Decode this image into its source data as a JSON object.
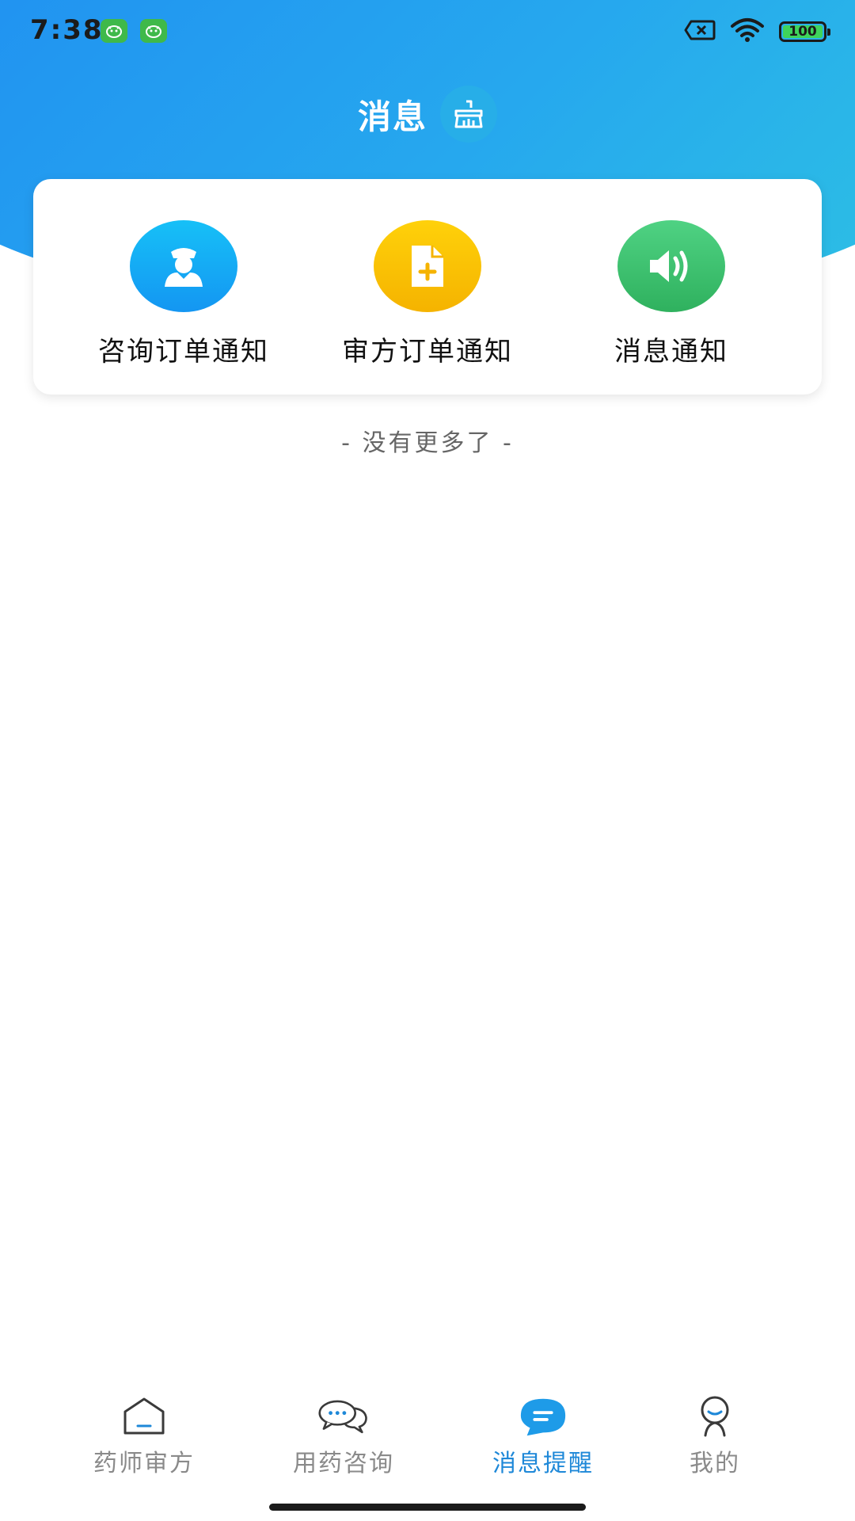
{
  "status_bar": {
    "time": "7:38",
    "battery": "100"
  },
  "header": {
    "title": "消息",
    "clean_icon": "broom-icon"
  },
  "entries": [
    {
      "label": "咨询订单通知",
      "icon": "doctor-icon",
      "color": "#1aa6f5"
    },
    {
      "label": "审方订单通知",
      "icon": "prescription-icon",
      "color": "#f5b800"
    },
    {
      "label": "消息通知",
      "icon": "speaker-icon",
      "color": "#3cc06a"
    }
  ],
  "list": {
    "end_text": "- 没有更多了 -"
  },
  "tabbar": {
    "active_color": "#1e88d8",
    "inactive_color": "#8a8a8a",
    "items": [
      {
        "label": "药师审方",
        "icon": "home-icon",
        "active": false
      },
      {
        "label": "用药咨询",
        "icon": "chat-bubbles-icon",
        "active": false
      },
      {
        "label": "消息提醒",
        "icon": "message-icon",
        "active": true
      },
      {
        "label": "我的",
        "icon": "profile-icon",
        "active": false
      }
    ]
  }
}
